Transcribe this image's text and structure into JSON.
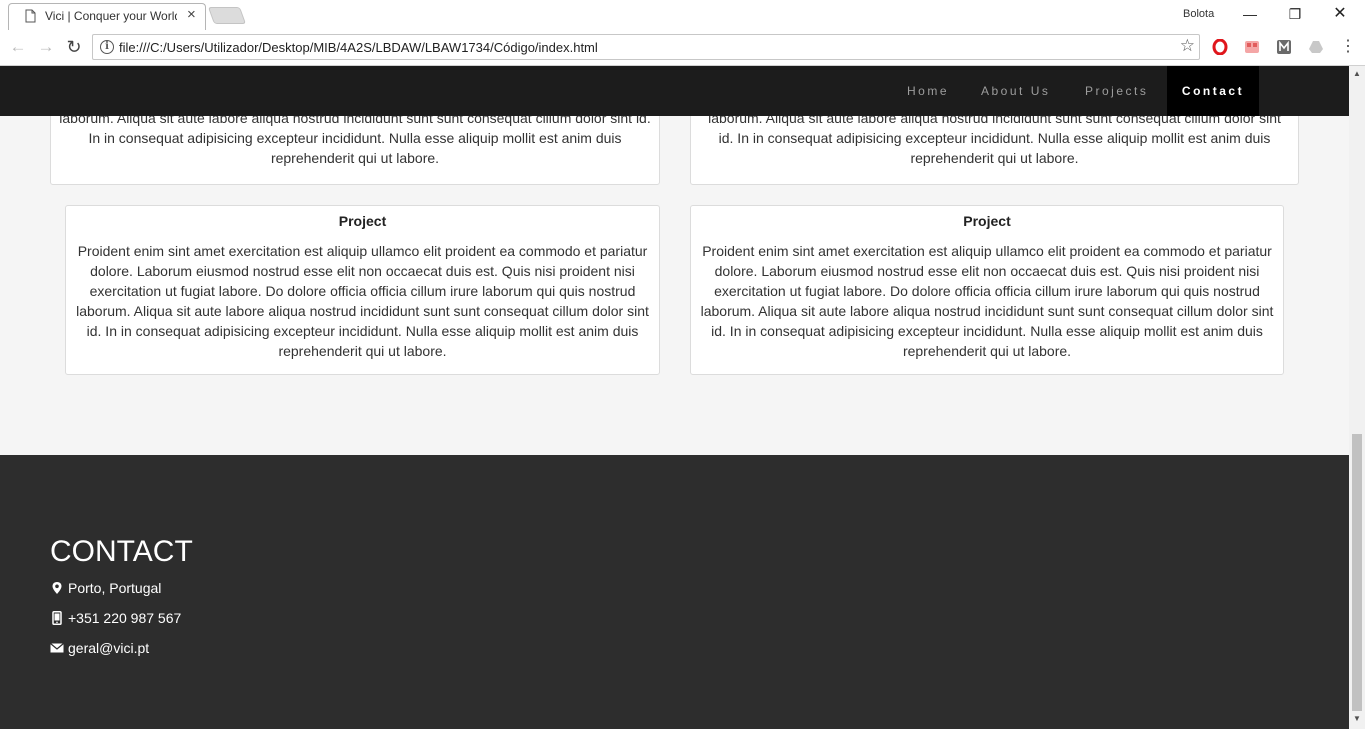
{
  "browser": {
    "tab_title": "Vici | Conquer your World",
    "profile_name": "Bolota",
    "url": "file:///C:/Users/Utilizador/Desktop/MIB/4A2S/LBDAW/LBAW1734/Código/index.html",
    "window_controls": {
      "minimize": "—",
      "restore": "❐",
      "close": "✕"
    }
  },
  "nav": {
    "items": [
      "Home",
      "About Us",
      "Projects",
      "Contact"
    ],
    "active": "Contact"
  },
  "projects": {
    "partial_text": "laborum. Aliqua sit aute labore aliqua nostrud incididunt sunt sunt consequat cillum dolor sint id. In in consequat adipisicing excepteur incididunt. Nulla esse aliquip mollit est anim duis reprehenderit qui ut labore.",
    "cards": [
      {
        "title": "Project",
        "body": "Proident enim sint amet exercitation est aliquip ullamco elit proident ea commodo et pariatur dolore. Laborum eiusmod nostrud esse elit non occaecat duis est. Quis nisi proident nisi exercitation ut fugiat labore. Do dolore officia officia cillum irure laborum qui quis nostrud laborum. Aliqua sit aute labore aliqua nostrud incididunt sunt sunt consequat cillum dolor sint id. In in consequat adipisicing excepteur incididunt. Nulla esse aliquip mollit est anim duis reprehenderit qui ut labore."
      },
      {
        "title": "Project",
        "body": "Proident enim sint amet exercitation est aliquip ullamco elit proident ea commodo et pariatur dolore. Laborum eiusmod nostrud esse elit non occaecat duis est. Quis nisi proident nisi exercitation ut fugiat labore. Do dolore officia officia cillum irure laborum qui quis nostrud laborum. Aliqua sit aute labore aliqua nostrud incididunt sunt sunt consequat cillum dolor sint id. In in consequat adipisicing excepteur incididunt. Nulla esse aliquip mollit est anim duis reprehenderit qui ut labore."
      }
    ]
  },
  "footer": {
    "heading": "CONTACT",
    "address": "Porto, Portugal",
    "phone": "+351 220 987 567",
    "email": "geral@vici.pt"
  },
  "colors": {
    "nav_bg": "#1c1c1c",
    "nav_active_bg": "#000000",
    "footer_bg": "#2d2d2d",
    "page_bg": "#f5f5f5"
  }
}
